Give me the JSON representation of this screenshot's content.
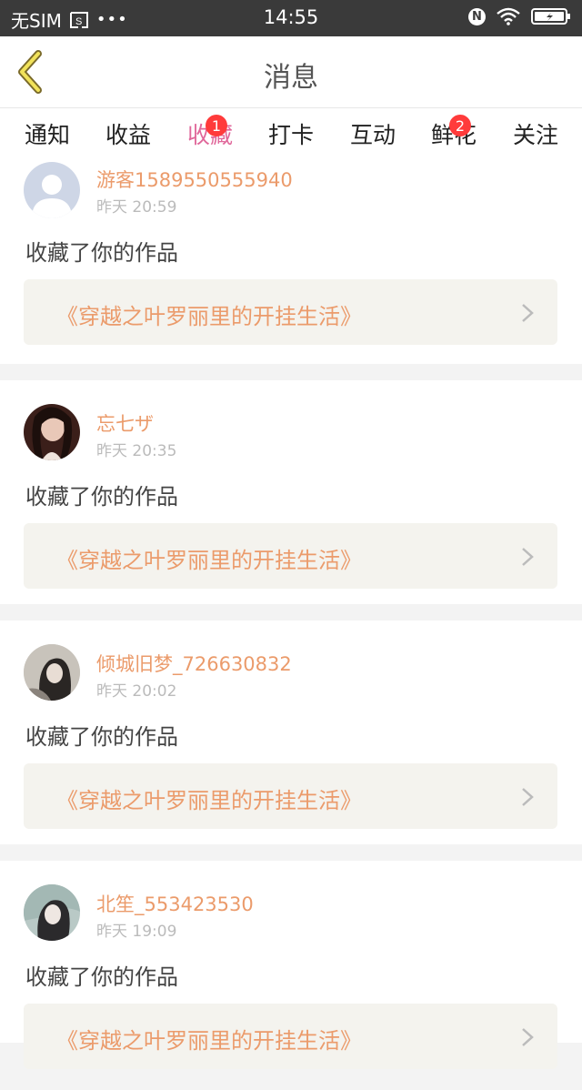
{
  "status_bar": {
    "carrier": "无SIM",
    "dots": "•••",
    "time": "14:55",
    "nfc_label": "N"
  },
  "header": {
    "title": "消息",
    "back_icon": "chevron-left-icon"
  },
  "tabs": [
    {
      "label": "通知",
      "badge": ""
    },
    {
      "label": "收益",
      "badge": ""
    },
    {
      "label": "收藏",
      "badge": "1",
      "active": true
    },
    {
      "label": "打卡",
      "badge": ""
    },
    {
      "label": "互动",
      "badge": ""
    },
    {
      "label": "鲜花",
      "badge": "2"
    },
    {
      "label": "关注",
      "badge": ""
    }
  ],
  "colors": {
    "accent": "#e0679a",
    "name_orange": "#eb9b6b",
    "badge_red": "#ff3b3b"
  },
  "messages": [
    {
      "username": "游客1589550555940",
      "time": "昨天 20:59",
      "action": "收藏了你的作品",
      "work_title": "《穿越之叶罗丽里的开挂生活》",
      "avatar": "default-avatar"
    },
    {
      "username": "忘七ザ",
      "time": "昨天 20:35",
      "action": "收藏了你的作品",
      "work_title": "《穿越之叶罗丽里的开挂生活》",
      "avatar": "photo-avatar"
    },
    {
      "username": "倾城旧梦_726630832",
      "time": "昨天 20:02",
      "action": "收藏了你的作品",
      "work_title": "《穿越之叶罗丽里的开挂生活》",
      "avatar": "photo-avatar"
    },
    {
      "username": "北笙_553423530",
      "time": "昨天 19:09",
      "action": "收藏了你的作品",
      "work_title": "《穿越之叶罗丽里的开挂生活》",
      "avatar": "photo-avatar"
    }
  ]
}
